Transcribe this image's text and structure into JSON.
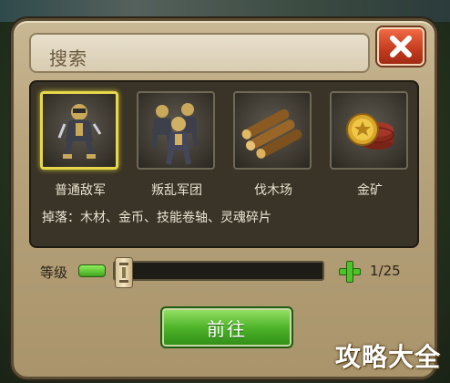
{
  "dialog": {
    "title": "搜索",
    "close_icon": "close-x-icon"
  },
  "categories": [
    {
      "label": "普通敌军",
      "icon": "soldier-icon",
      "selected": true
    },
    {
      "label": "叛乱军团",
      "icon": "soldier-group-icon",
      "selected": false
    },
    {
      "label": "伐木场",
      "icon": "logs-icon",
      "selected": false
    },
    {
      "label": "金矿",
      "icon": "gold-coins-icon",
      "selected": false
    }
  ],
  "drops": "掉落：木材、金币、技能卷轴、灵魂碎片",
  "level": {
    "label": "等级",
    "value_text": "1/25",
    "current": 1,
    "max": 25
  },
  "go_button": "前往",
  "watermark": "攻略大全",
  "colors": {
    "accent_green": "#4fb52a",
    "close_red": "#c33a1e",
    "selected_border": "#e6d84a"
  }
}
